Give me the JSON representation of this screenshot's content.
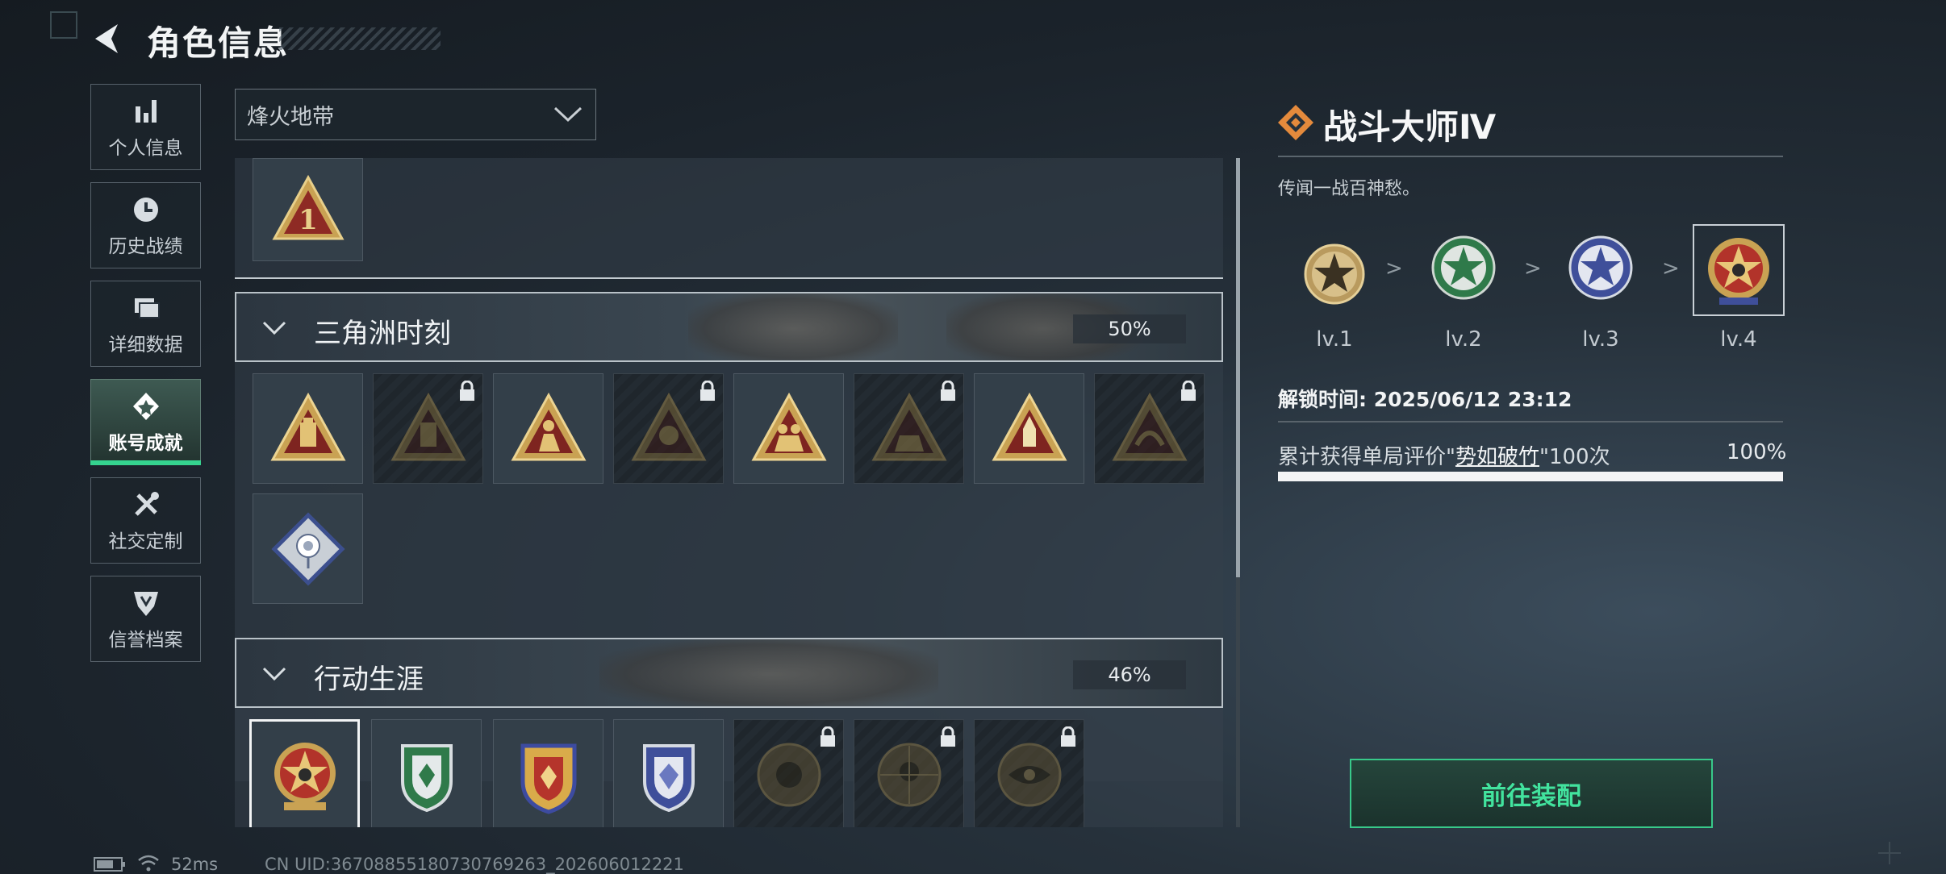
{
  "header": {
    "title": "角色信息"
  },
  "nav": [
    {
      "label": "个人信息",
      "icon": "bar-chart-icon",
      "active": false
    },
    {
      "label": "历史战绩",
      "icon": "history-icon",
      "active": false
    },
    {
      "label": "详细数据",
      "icon": "cards-icon",
      "active": false
    },
    {
      "label": "账号成就",
      "icon": "achievement-icon",
      "active": true
    },
    {
      "label": "社交定制",
      "icon": "tools-icon",
      "active": false
    },
    {
      "label": "信誉档案",
      "icon": "credit-shield-icon",
      "active": false
    }
  ],
  "season_select": {
    "value": "烽火地带"
  },
  "groups": [
    {
      "name": "三角洲时刻",
      "percent": "50%"
    },
    {
      "name": "行动生涯",
      "percent": "46%"
    }
  ],
  "detail": {
    "title": "战斗大师Ⅳ",
    "description": "传闻一战百神愁。",
    "levels": [
      "lv.1",
      "lv.2",
      "lv.3",
      "lv.4"
    ],
    "arrow": ">",
    "unlock_time": "解锁时间: 2025/06/12 23:12",
    "requirement_prefix": "累计获得单局评价\"",
    "requirement_keyword": "势如破竹",
    "requirement_suffix": "\"100次",
    "progress_text": "100%",
    "progress": 1.0,
    "equip_button": "前往装配"
  },
  "status": {
    "ping": "52ms",
    "uid": "CN UID:36708855180730769263_202606012221"
  },
  "colors": {
    "accent_green": "#35d38f",
    "badge_gold": "#c9a253",
    "badge_red": "#8e2a24",
    "badge_green": "#2f7a4a",
    "badge_blue": "#3f4f9a"
  }
}
